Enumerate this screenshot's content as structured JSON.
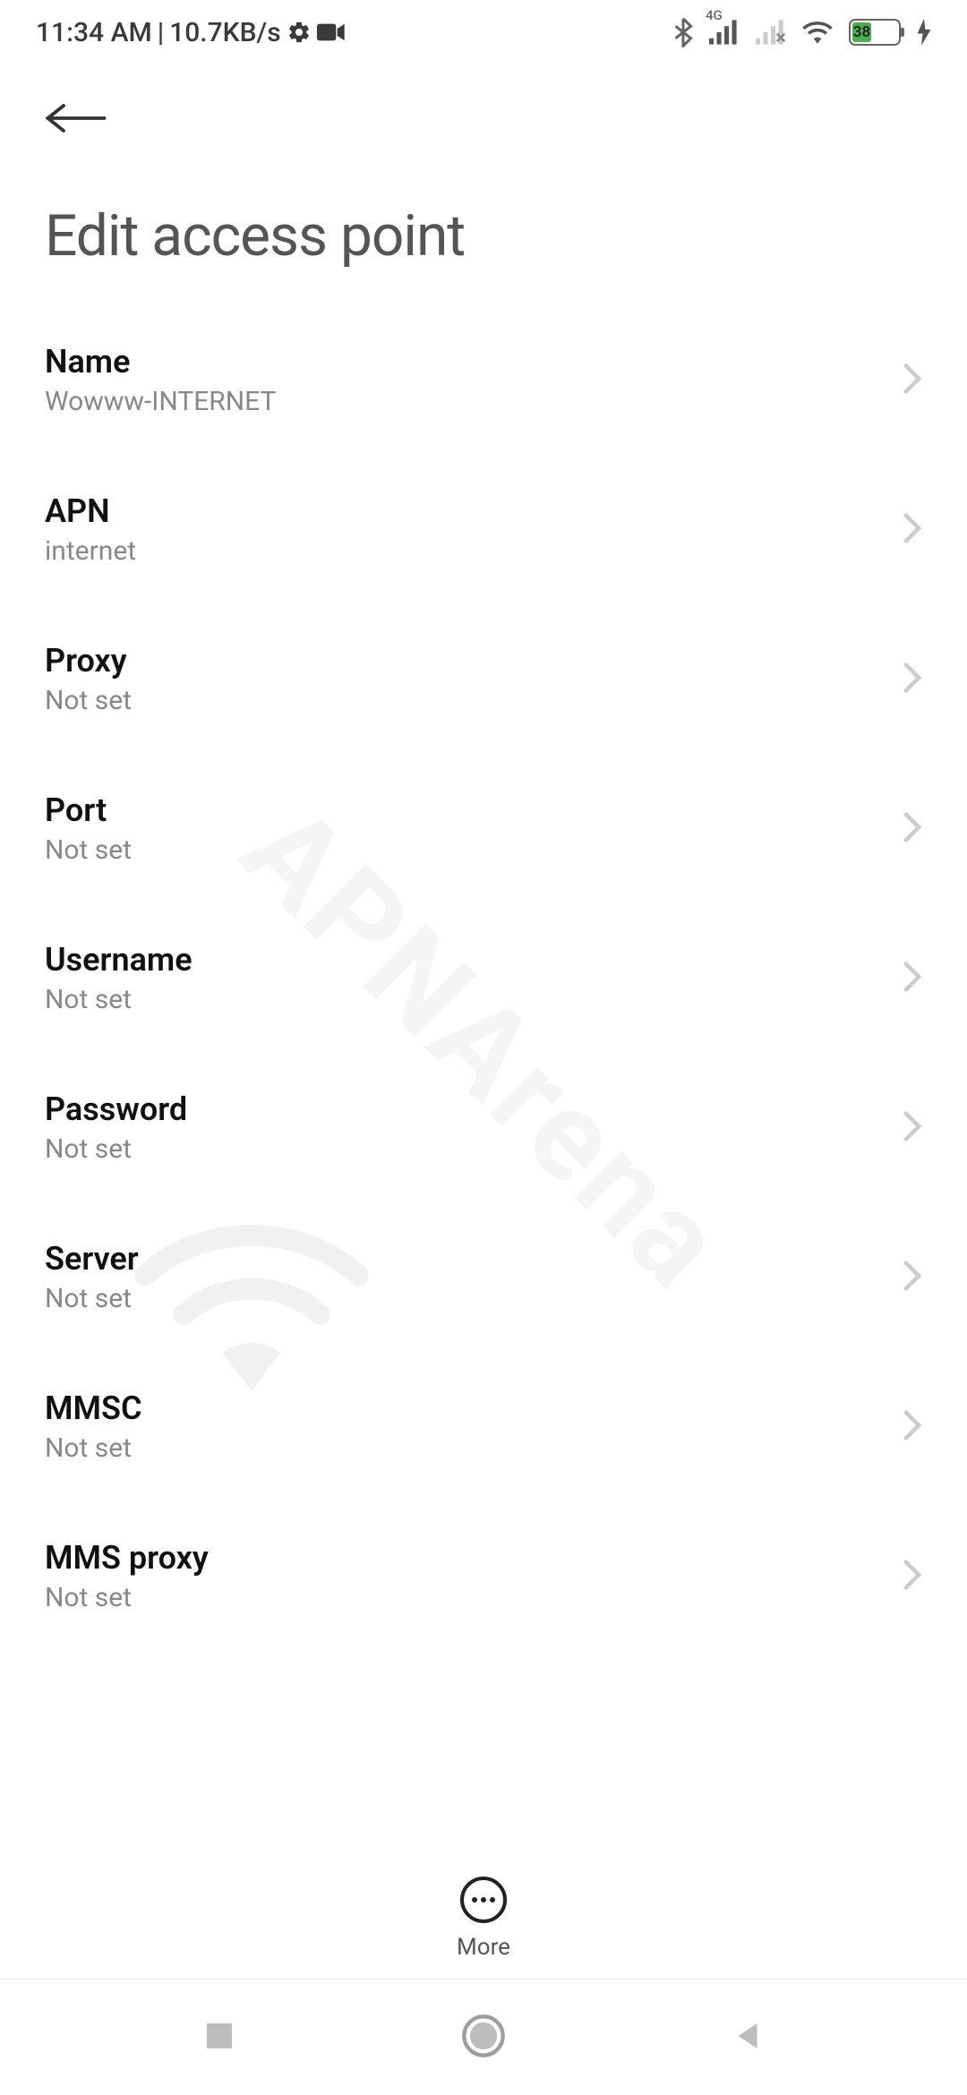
{
  "status": {
    "time": "11:34 AM",
    "speed": "10.7KB/s",
    "network_label": "4G",
    "battery_pct": "38"
  },
  "page_title": "Edit access point",
  "settings": [
    {
      "label": "Name",
      "value": "Wowww-INTERNET"
    },
    {
      "label": "APN",
      "value": "internet"
    },
    {
      "label": "Proxy",
      "value": "Not set"
    },
    {
      "label": "Port",
      "value": "Not set"
    },
    {
      "label": "Username",
      "value": "Not set"
    },
    {
      "label": "Password",
      "value": "Not set"
    },
    {
      "label": "Server",
      "value": "Not set"
    },
    {
      "label": "MMSC",
      "value": "Not set"
    },
    {
      "label": "MMS proxy",
      "value": "Not set"
    }
  ],
  "more_label": "More",
  "watermark": "APNArena"
}
